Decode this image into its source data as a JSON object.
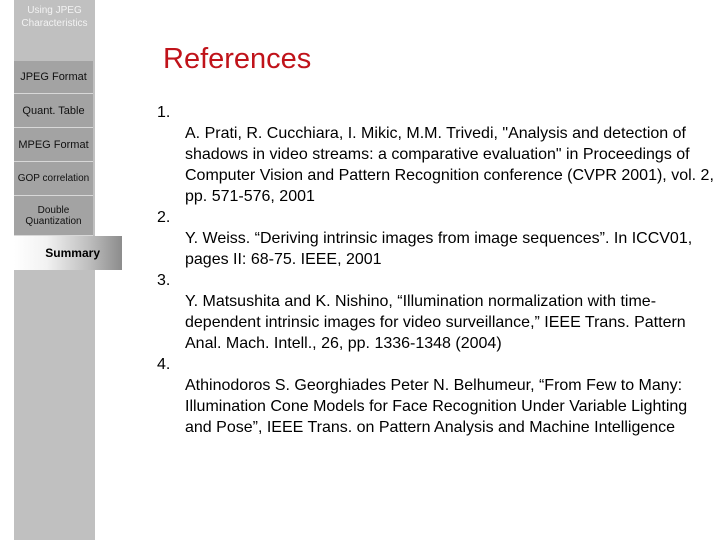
{
  "sidebar": {
    "title": "Using JPEG Characteristics",
    "items": [
      {
        "label": "JPEG Format"
      },
      {
        "label": "Quant. Table"
      },
      {
        "label": "MPEG Format"
      },
      {
        "label": "GOP correlation"
      },
      {
        "label": "Double Quantization"
      },
      {
        "label": "Summary",
        "active": true
      }
    ]
  },
  "slide": {
    "title": "References",
    "title_color": "#c0131a",
    "references": [
      {
        "number": "1.",
        "text": "A. Prati, R. Cucchiara, I. Mikic, M.M. Trivedi, \"Analysis and detection of shadows in video streams: a comparative evaluation\" in Proceedings of Computer Vision and Pattern Recognition conference (CVPR 2001), vol. 2, pp. 571-576, 2001"
      },
      {
        "number": "2.",
        "text": "Y. Weiss. “Deriving intrinsic images from image sequences”. In ICCV01, pages II: 68-75. IEEE, 2001"
      },
      {
        "number": "3.",
        "text": "Y. Matsushita and K. Nishino, “Illumination normalization with time-dependent intrinsic images for video surveillance,” IEEE Trans. Pattern Anal. Mach. Intell., 26, pp. 1336-1348 (2004)"
      },
      {
        "number": "4.",
        "text": "Athinodoros S. Georghiades Peter N. Belhumeur, “From Few to Many: Illumination Cone Models for Face Recognition Under Variable Lighting and Pose”, IEEE Trans. on Pattern Analysis and Machine Intelligence"
      }
    ]
  }
}
